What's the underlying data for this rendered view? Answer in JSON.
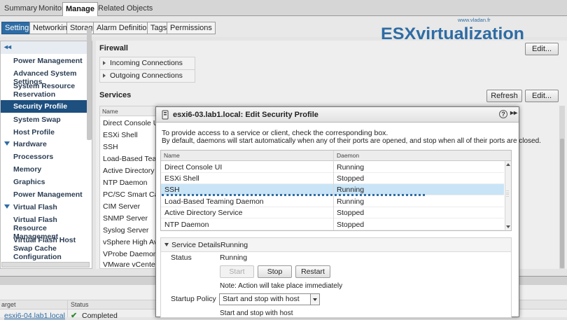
{
  "top_tabs": [
    "Summary",
    "Monitor",
    "Manage",
    "Related Objects"
  ],
  "sub_tabs": [
    "Settings",
    "Networking",
    "Storage",
    "Alarm Definitions",
    "Tags",
    "Permissions"
  ],
  "sidebar": {
    "collapse": "◂◂",
    "items": [
      "Power Management",
      "Advanced System Settings",
      "System Resource Reservation",
      "Security Profile",
      "System Swap",
      "Host Profile"
    ],
    "groups": [
      {
        "title": "Hardware",
        "items": [
          "Processors",
          "Memory",
          "Graphics",
          "Power Management"
        ]
      },
      {
        "title": "Virtual Flash",
        "items": [
          "Virtual Flash Resource Management",
          "Virtual Flash Host Swap Cache Configuration"
        ]
      }
    ]
  },
  "firewall": {
    "title": "Firewall",
    "edit_label": "Edit...",
    "rows": [
      "Incoming Connections",
      "Outgoing Connections"
    ]
  },
  "services": {
    "title": "Services",
    "refresh_label": "Refresh",
    "edit_label": "Edit...",
    "col_name": "Name",
    "rows": [
      "Direct Console UI",
      "ESXi Shell",
      "SSH",
      "Load-Based Teaming",
      "Active Directory Ser",
      "NTP Daemon",
      "PC/SC Smart Card",
      "CIM Server",
      "SNMP Server",
      "Syslog Server",
      "vSphere High Availa",
      "VProbe Daemon",
      "VMware vCenter Ag"
    ]
  },
  "logo": {
    "site": "www.vladan.fr",
    "brand": "ESXvirtualization"
  },
  "tasks": {
    "col_target": "arget",
    "col_status": "Status",
    "row_target": "esxi6-04.lab1.local",
    "row_status": "Completed"
  },
  "dialog": {
    "title": "esxi6-03.lab1.local: Edit Security Profile",
    "help": "?",
    "expand": "▸▸",
    "intro1": "To provide access to a service or client, check the corresponding box.",
    "intro2": "By default, daemons will start automatically when any of their ports are opened, and stop when all of their ports are closed.",
    "col_name": "Name",
    "col_daemon": "Daemon",
    "rows": [
      {
        "name": "Direct Console UI",
        "daemon": "Running"
      },
      {
        "name": "ESXi Shell",
        "daemon": "Stopped"
      },
      {
        "name": "SSH",
        "daemon": "Running"
      },
      {
        "name": "Load-Based Teaming Daemon",
        "daemon": "Running"
      },
      {
        "name": "Active Directory Service",
        "daemon": "Stopped"
      },
      {
        "name": "NTP Daemon",
        "daemon": "Stopped"
      }
    ],
    "details": {
      "header_label": "Service Details",
      "header_value": "Running",
      "status_label": "Status",
      "status_value": "Running",
      "start_label": "Start",
      "stop_label": "Stop",
      "restart_label": "Restart",
      "note": "Note: Action will take place immediately",
      "policy_label": "Startup Policy",
      "policy_value": "Start and stop with host",
      "policy_desc": "Start and stop with host"
    }
  }
}
